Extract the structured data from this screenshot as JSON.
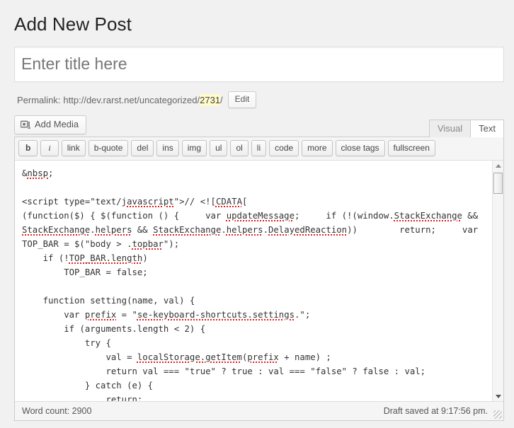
{
  "page": {
    "title": "Add New Post"
  },
  "title_field": {
    "placeholder": "Enter title here",
    "value": ""
  },
  "permalink": {
    "label": "Permalink:",
    "url_prefix": "http://dev.rarst.net/uncategorized/",
    "slug": "2731",
    "url_suffix": "/",
    "edit_label": "Edit",
    "highlight_color": "#fffbcc"
  },
  "media": {
    "add_media_label": "Add Media",
    "icon": "media-camera-icon"
  },
  "editor_tabs": [
    {
      "label": "Visual",
      "active": false
    },
    {
      "label": "Text",
      "active": true
    }
  ],
  "quicktags": [
    {
      "label": "b",
      "style": "bold"
    },
    {
      "label": "i",
      "style": "italic"
    },
    {
      "label": "link",
      "style": ""
    },
    {
      "label": "b-quote",
      "style": ""
    },
    {
      "label": "del",
      "style": ""
    },
    {
      "label": "ins",
      "style": ""
    },
    {
      "label": "img",
      "style": ""
    },
    {
      "label": "ul",
      "style": ""
    },
    {
      "label": "ol",
      "style": ""
    },
    {
      "label": "li",
      "style": ""
    },
    {
      "label": "code",
      "style": ""
    },
    {
      "label": "more",
      "style": ""
    },
    {
      "label": "close tags",
      "style": ""
    },
    {
      "label": "fullscreen",
      "style": ""
    }
  ],
  "editor": {
    "content": "&nbsp;\n\n<script type=\"text/javascript\">// <![CDATA[\n(function($) { $(function () {     var updateMessage;     if (!(window.StackExchange && StackExchange.helpers && StackExchange.helpers.DelayedReaction))        return;     var TOP_BAR = $(\"body > .topbar\");\n    if (!TOP_BAR.length)\n        TOP_BAR = false;\n\n    function setting(name, val) {\n        var prefix = \"se-keyboard-shortcuts.settings.\";\n        if (arguments.length < 2) {\n            try {\n                val = localStorage.getItem(prefix + name) ;\n                return val === \"true\" ? true : val === \"false\" ? false : val;\n            } catch (e) {\n                return;"
  },
  "statusbar": {
    "word_count_label": "Word count: 2900",
    "autosave_label": "Draft saved at 9:17:56 pm."
  },
  "scrollbar": {
    "up_icon": "triangle-up-icon",
    "down_icon": "triangle-down-icon",
    "thumb": "scrollbar-thumb"
  },
  "colors": {
    "page_bg": "#f1f1f1",
    "panel_bg": "#ffffff",
    "border": "#cccccc",
    "text": "#444444",
    "muted": "#666666",
    "spellcheck_underline": "#e02020"
  }
}
